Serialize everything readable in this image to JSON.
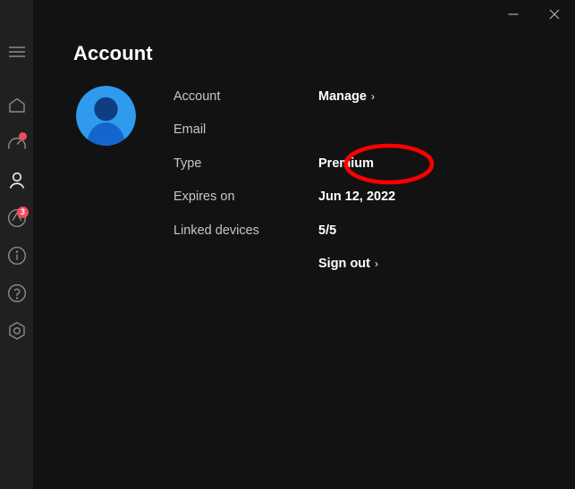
{
  "window": {
    "controls": [
      {
        "name": "minimize",
        "label": "Minimize",
        "glyph": "minimize-icon"
      },
      {
        "name": "close",
        "label": "Close",
        "glyph": "close-icon"
      }
    ]
  },
  "sidebar": {
    "items": [
      {
        "icon": "hamburger-menu-icon",
        "label": "Menu",
        "active": false,
        "badge": null
      },
      {
        "icon": "home-icon",
        "label": "Home",
        "active": false,
        "badge": null
      },
      {
        "icon": "gauge-icon",
        "label": "Performance",
        "active": false,
        "badge": "dot"
      },
      {
        "icon": "person-icon",
        "label": "Account",
        "active": true,
        "badge": null
      },
      {
        "icon": "shield-update-icon",
        "label": "Updates",
        "active": false,
        "badge": "3"
      },
      {
        "icon": "info-icon",
        "label": "Information",
        "active": false,
        "badge": null
      },
      {
        "icon": "help-icon",
        "label": "Help",
        "active": false,
        "badge": null
      },
      {
        "icon": "settings-hexagon-icon",
        "label": "Settings",
        "active": false,
        "badge": null
      }
    ]
  },
  "page": {
    "title": "Account",
    "avatar": {
      "name": "user-avatar",
      "circle_color": "#2f9bed",
      "head_color": "#0e3e82",
      "body_color": "#1565cf"
    },
    "rows": [
      {
        "label": "Account",
        "value": "Manage",
        "type": "link",
        "chevron": "›"
      },
      {
        "label": "Email",
        "value": "",
        "type": "value",
        "chevron": ""
      },
      {
        "label": "Type",
        "value": "Premium",
        "type": "value",
        "chevron": ""
      },
      {
        "label": "Expires on",
        "value": "Jun 12, 2022",
        "type": "value",
        "chevron": ""
      },
      {
        "label": "Linked devices",
        "value": "5/5",
        "type": "value",
        "chevron": ""
      },
      {
        "label": "",
        "value": "Sign out",
        "type": "link",
        "chevron": "›"
      }
    ]
  },
  "annotation": {
    "shape": "ellipse",
    "color": "#ff0000",
    "target": "Premium"
  },
  "colors": {
    "sidebar_bg": "#202020",
    "content_bg": "#121212",
    "badge_red": "#f24a5c",
    "accent_blue": "#2f9bed",
    "annotation_red": "#ff0000"
  }
}
